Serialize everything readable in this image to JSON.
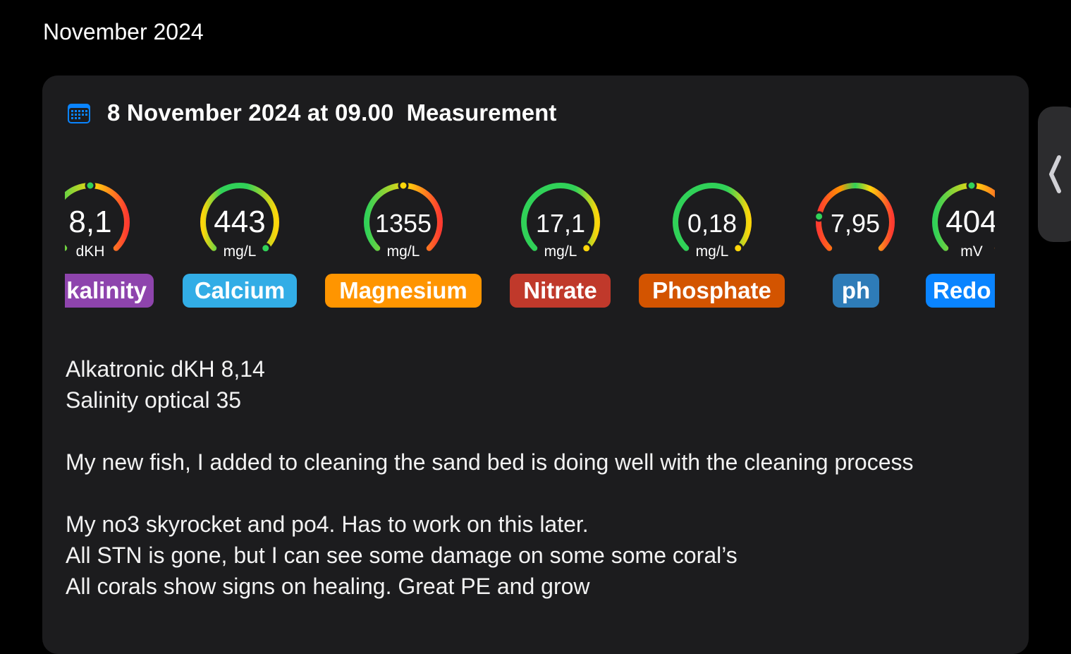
{
  "month_header": "November 2024",
  "entry": {
    "title": "8 November 2024 at 09.00",
    "kind": "Measurement",
    "icon": "calendar-icon"
  },
  "gauges": [
    {
      "value": "8,1",
      "unit": "dKH",
      "label": "Alkalinity",
      "label_visible": "kalinity",
      "pill_color": "#8e44ad",
      "indicator_fraction": 0.5
    },
    {
      "value": "443",
      "unit": "mg/L",
      "label": "Calcium",
      "pill_color": "#32ade6",
      "indicator_fraction": 1.0
    },
    {
      "value": "1355",
      "unit": "mg/L",
      "label": "Magnesium",
      "pill_color": "#ff9500",
      "indicator_fraction": 0.5
    },
    {
      "value": "17,1",
      "unit": "mg/L",
      "label": "Nitrate",
      "pill_color": "#c0392b",
      "indicator_fraction": 1.0
    },
    {
      "value": "0,18",
      "unit": "mg/L",
      "label": "Phosphate",
      "pill_color": "#d35400",
      "indicator_fraction": 1.0
    },
    {
      "value": "7,95",
      "unit": "",
      "label": "ph",
      "pill_color": "#2e7cb8",
      "indicator_fraction": 0.2
    },
    {
      "value": "404",
      "unit": "mV",
      "label": "Redox",
      "label_visible": "Redo",
      "pill_color": "#0a84ff",
      "indicator_fraction": 0.5
    }
  ],
  "notes": [
    "Alkatronic dKH 8,14",
    "Salinity optical 35",
    "",
    "My new fish, I added to cleaning the sand bed is doing well with the cleaning process",
    "",
    "My no3 skyrocket and po4. Has to work on this later.",
    "All STN is gone, but I can see some damage on some some coral’s",
    "All corals show signs on healing. Great PE and grow"
  ],
  "side_tab_icon": "chevron-left-icon"
}
